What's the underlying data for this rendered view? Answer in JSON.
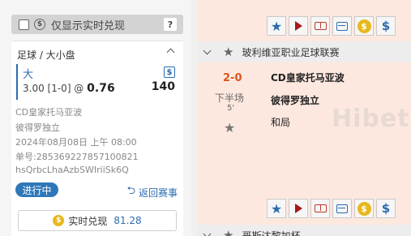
{
  "filter": {
    "checked": false,
    "icon": "dollar-coin-outline-icon",
    "label": "仅显示实时兑现",
    "help": "?"
  },
  "bet": {
    "market": "足球 / 大小盘",
    "selection": "大",
    "currency_icon": "$",
    "line": "3.00 [1-0] @",
    "odds": "0.76",
    "stake": "140",
    "home": "CD皇家托马亚波",
    "away": "彼得罗独立",
    "time": "2024年08月08日 上午 08:00",
    "ticket": "单号:285369227857100821",
    "code": "hsQrbcLhaAzbSWIriiSk6Q",
    "status": "进行中",
    "return_label": "返回赛事",
    "cashout_label": "实时兑现",
    "cashout_value": "81.28",
    "coin_icon": "$"
  },
  "events": {
    "league1": "玻利维亚职业足球联赛",
    "league2": "哥斯达黎加杯",
    "match": {
      "score": "2-0",
      "period": "下半场",
      "minute": "5'",
      "home": "CD皇家托马亚波",
      "away": "彼得罗独立",
      "draw": "和局"
    },
    "watermark": "Hibet"
  },
  "colors": {
    "accent": "#2b6cb0",
    "status": "#2f78b8",
    "score": "#d9541e",
    "coin": "#e8b71c",
    "band": "#fde8df"
  }
}
